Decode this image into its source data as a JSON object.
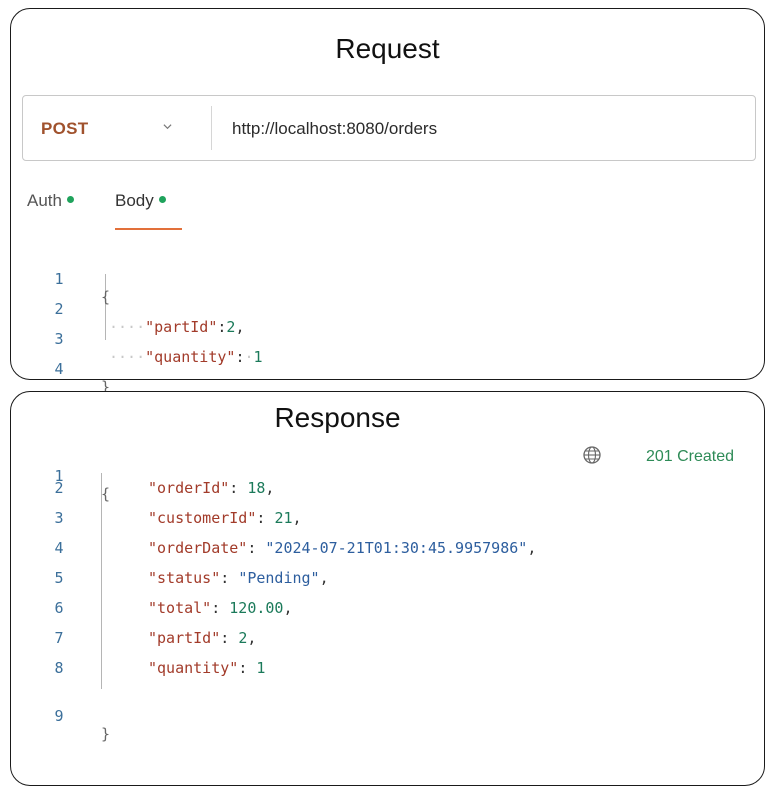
{
  "request": {
    "title": "Request",
    "method": "POST",
    "url": "http://localhost:8080/orders",
    "tabs": [
      {
        "label": "Auth"
      },
      {
        "label": "Body"
      }
    ],
    "line_numbers": [
      "1",
      "2",
      "3",
      "4"
    ],
    "open_brace": "{",
    "close_brace": "}",
    "body": {
      "l2_key": "\"partId\"",
      "l2_sep": ":",
      "l2_val": "2",
      "l2_tail": ",",
      "l3_key": "\"quantity\"",
      "l3_sep": ":",
      "l3_val": "1"
    }
  },
  "response": {
    "title": "Response",
    "status": "201 Created",
    "line_numbers": [
      "1",
      "2",
      "3",
      "4",
      "5",
      "6",
      "7",
      "8",
      "9"
    ],
    "open_brace": "{",
    "close_brace": "}",
    "fields": [
      {
        "key": "\"orderId\"",
        "value": "18",
        "type": "num",
        "comma": ","
      },
      {
        "key": "\"customerId\"",
        "value": "21",
        "type": "num",
        "comma": ","
      },
      {
        "key": "\"orderDate\"",
        "value": "\"2024-07-21T01:30:45.9957986\"",
        "type": "str",
        "comma": ","
      },
      {
        "key": "\"status\"",
        "value": "\"Pending\"",
        "type": "str",
        "comma": ","
      },
      {
        "key": "\"total\"",
        "value": "120.00",
        "type": "num",
        "comma": ","
      },
      {
        "key": "\"partId\"",
        "value": "2",
        "type": "num",
        "comma": ","
      },
      {
        "key": "\"quantity\"",
        "value": "1",
        "type": "num",
        "comma": ""
      }
    ]
  },
  "colors": {
    "method": "#a0522d",
    "key": "#a23b2a",
    "string": "#2d5e9e",
    "number": "#1b7a5a",
    "status": "#2e8b57",
    "tab_dot": "#1fa35c",
    "tab_underline": "#e2703a"
  },
  "icons": {
    "method_dropdown": "chevron-down-icon",
    "network": "globe-icon"
  }
}
